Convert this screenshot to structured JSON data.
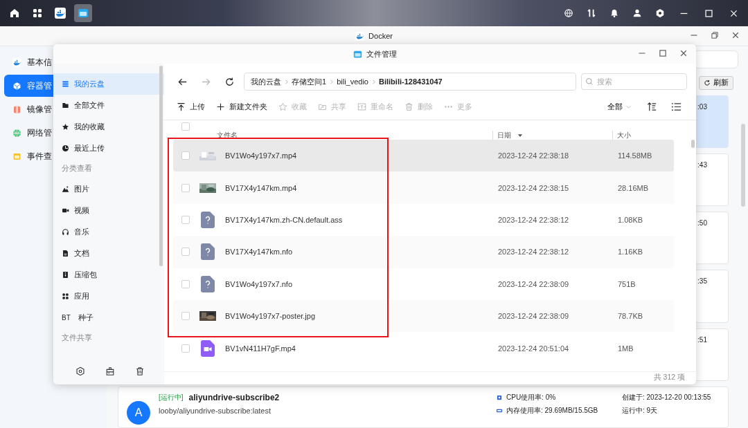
{
  "taskbar": [
    {
      "selected": false
    },
    {
      "selected": false
    },
    {
      "selected": false
    },
    {
      "selected": true
    }
  ],
  "docker": {
    "title": "Docker",
    "sidebar": [
      {
        "label": "基本信",
        "selected": false
      },
      {
        "label": "容器管",
        "selected": true
      },
      {
        "label": "镜像管",
        "selected": false
      },
      {
        "label": "网络管",
        "selected": false
      },
      {
        "label": "事件查",
        "selected": false
      }
    ],
    "refresh": "刷新",
    "cards": [
      {
        "time": ":03",
        "selected": true
      },
      {
        "time": ":43",
        "selected": false
      },
      {
        "time": ":50",
        "selected": false
      },
      {
        "time": ":35",
        "selected": false
      },
      {
        "time": ":51",
        "selected": false
      }
    ],
    "container": {
      "status": "[运行中]",
      "name": "aliyundrive-subscribe2",
      "image": "looby/aliyundrive-subscribe:latest",
      "avatar": "A",
      "cpu": "CPU使用率: 0%",
      "memory": "内存使用率: 29.69MB/15.5GB",
      "created": "创建于: 2023-12-20 00:13:55",
      "uptime": "运行中: 9天"
    }
  },
  "files": {
    "title": "文件管理",
    "nav": [
      {
        "label": "我的云盘",
        "selected": true
      },
      {
        "label": "全部文件",
        "selected": false
      },
      {
        "label": "我的收藏",
        "selected": false
      },
      {
        "label": "最近上传",
        "selected": false
      }
    ],
    "section_1": "分类查看",
    "categories": [
      {
        "label": "图片"
      },
      {
        "label": "视频"
      },
      {
        "label": "音乐"
      },
      {
        "label": "文档"
      },
      {
        "label": "压缩包"
      },
      {
        "label": "应用"
      },
      {
        "label": "种子",
        "icon_text": "BT"
      }
    ],
    "section_2": "文件共享",
    "back": {
      "disabled": false
    },
    "forward": {
      "disabled": true
    },
    "breadcrumb": [
      "我的云盘",
      "存储空间1",
      "bili_vedio",
      "Bilibili-128431047"
    ],
    "search": {
      "placeholder": "搜索"
    },
    "toolbar": [
      {
        "label": "上传",
        "disabled": false
      },
      {
        "label": "新建文件夹",
        "disabled": false
      },
      {
        "label": "收藏",
        "disabled": true
      },
      {
        "label": "共享",
        "disabled": true
      },
      {
        "label": "重命名",
        "disabled": true
      },
      {
        "label": "删除",
        "disabled": true
      },
      {
        "label": "更多",
        "disabled": true
      }
    ],
    "filter": "全部",
    "header_checked": false,
    "columns": [
      {
        "label": "文件名",
        "sorted": false
      },
      {
        "label": "日期",
        "sorted": true
      },
      {
        "label": "大小",
        "sorted": false
      }
    ],
    "rows": [
      {
        "name": "BV1Wo4y197x7.mp4",
        "date": "2023-12-24 22:38:18",
        "size": "114.58MB",
        "kind": "thumbnail",
        "checked": false,
        "highlighted": true
      },
      {
        "name": "BV17X4y147km.mp4",
        "date": "2023-12-24 22:38:15",
        "size": "28.16MB",
        "kind": "thumbnail",
        "checked": false,
        "highlighted": false
      },
      {
        "name": "BV17X4y147km.zh-CN.default.ass",
        "date": "2023-12-24 22:38:12",
        "size": "1.08KB",
        "kind": "unknown",
        "checked": false,
        "highlighted": false
      },
      {
        "name": "BV17X4y147km.nfo",
        "date": "2023-12-24 22:38:12",
        "size": "1.16KB",
        "kind": "unknown",
        "checked": false,
        "highlighted": false
      },
      {
        "name": "BV1Wo4y197x7.nfo",
        "date": "2023-12-24 22:38:09",
        "size": "751B",
        "kind": "unknown",
        "checked": false,
        "highlighted": false
      },
      {
        "name": "BV1Wo4y197x7-poster.jpg",
        "date": "2023-12-24 22:38:09",
        "size": "78.7KB",
        "kind": "thumbnail",
        "checked": false,
        "highlighted": false
      },
      {
        "name": "BV1vN411H7gF.mp4",
        "date": "2023-12-24 20:51:04",
        "size": "1MB",
        "kind": "video",
        "checked": false,
        "highlighted": false
      }
    ],
    "total": "共 312 项"
  }
}
